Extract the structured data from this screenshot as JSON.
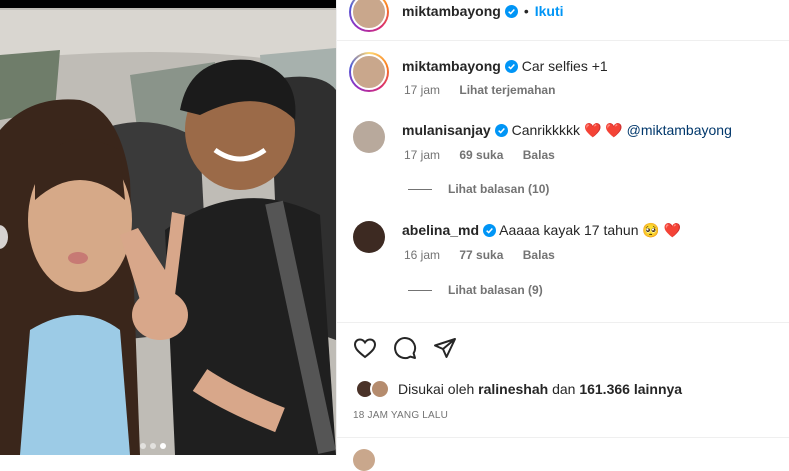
{
  "post": {
    "author": "miktambayong",
    "follow_label": "Ikuti",
    "separator": "•"
  },
  "caption": {
    "username": "miktambayong",
    "text": "Car selfies +1",
    "time": "17 jam",
    "translate_label": "Lihat terjemahan"
  },
  "comments": [
    {
      "username": "mulanisanjay",
      "text": "Canrikkkkk",
      "hearts": "❤️ ❤️",
      "mention": "@miktambayong",
      "time": "17 jam",
      "likes": "69 suka",
      "reply_label": "Balas",
      "view_replies": "Lihat balasan (10)"
    },
    {
      "username": "abelina_md",
      "text": "Aaaaa kayak 17 tahun",
      "emoji": "🥺 ❤️",
      "time": "16 jam",
      "likes": "77 suka",
      "reply_label": "Balas",
      "view_replies": "Lihat balasan (9)"
    }
  ],
  "actions": {
    "like_icon": "heart-icon",
    "comment_icon": "comment-icon",
    "share_icon": "share-icon"
  },
  "likes_summary": {
    "prefix": "Disukai oleh",
    "user": "ralineshah",
    "conj": "dan",
    "count": "161.366 lainnya"
  },
  "timestamp": "18 JAM YANG LALU",
  "colors": {
    "follow_blue": "#0095f6",
    "verified_blue": "#0095f6",
    "muted": "#737373",
    "heart_red": "#ed1c24"
  }
}
